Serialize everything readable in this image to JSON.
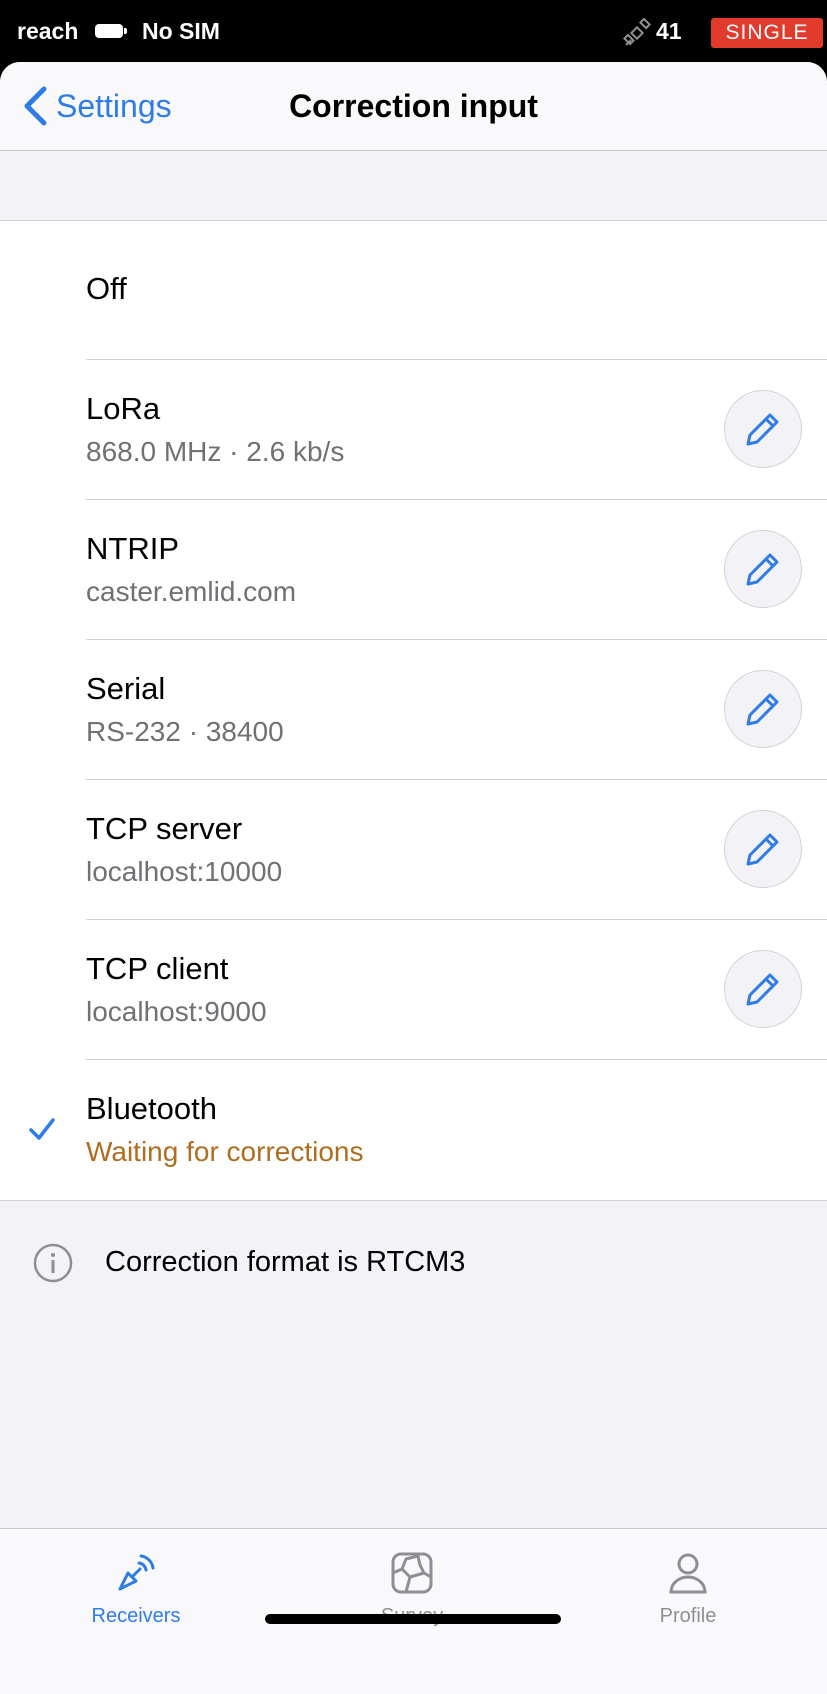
{
  "status_bar": {
    "carrier": "reach",
    "sim": "No SIM",
    "satellites": "41",
    "solution_badge": "SINGLE"
  },
  "nav": {
    "back_label": "Settings",
    "title": "Correction input"
  },
  "options": [
    {
      "title": "Off",
      "subtitle": ""
    },
    {
      "title": "LoRa",
      "subtitle": "868.0 MHz · 2.6 kb/s"
    },
    {
      "title": "NTRIP",
      "subtitle": "caster.emlid.com"
    },
    {
      "title": "Serial",
      "subtitle": "RS-232 · 38400"
    },
    {
      "title": "TCP server",
      "subtitle": "localhost:10000"
    },
    {
      "title": "TCP client",
      "subtitle": "localhost:9000"
    },
    {
      "title": "Bluetooth",
      "subtitle": "Waiting for corrections",
      "selected": true
    }
  ],
  "info": {
    "text": "Correction format is RTCM3"
  },
  "tabs": [
    {
      "label": "Receivers",
      "active": true
    },
    {
      "label": "Survey",
      "active": false
    },
    {
      "label": "Profile",
      "active": false
    }
  ],
  "colors": {
    "accent": "#2f7ce8",
    "badge": "#e23b2e",
    "warning_text": "#b06d1f",
    "inactive": "#8e8e93"
  },
  "icons": [
    "chevron-left-icon",
    "satellite-icon",
    "pencil-icon",
    "checkmark-icon",
    "info-icon",
    "receivers-icon",
    "survey-icon",
    "profile-icon"
  ]
}
